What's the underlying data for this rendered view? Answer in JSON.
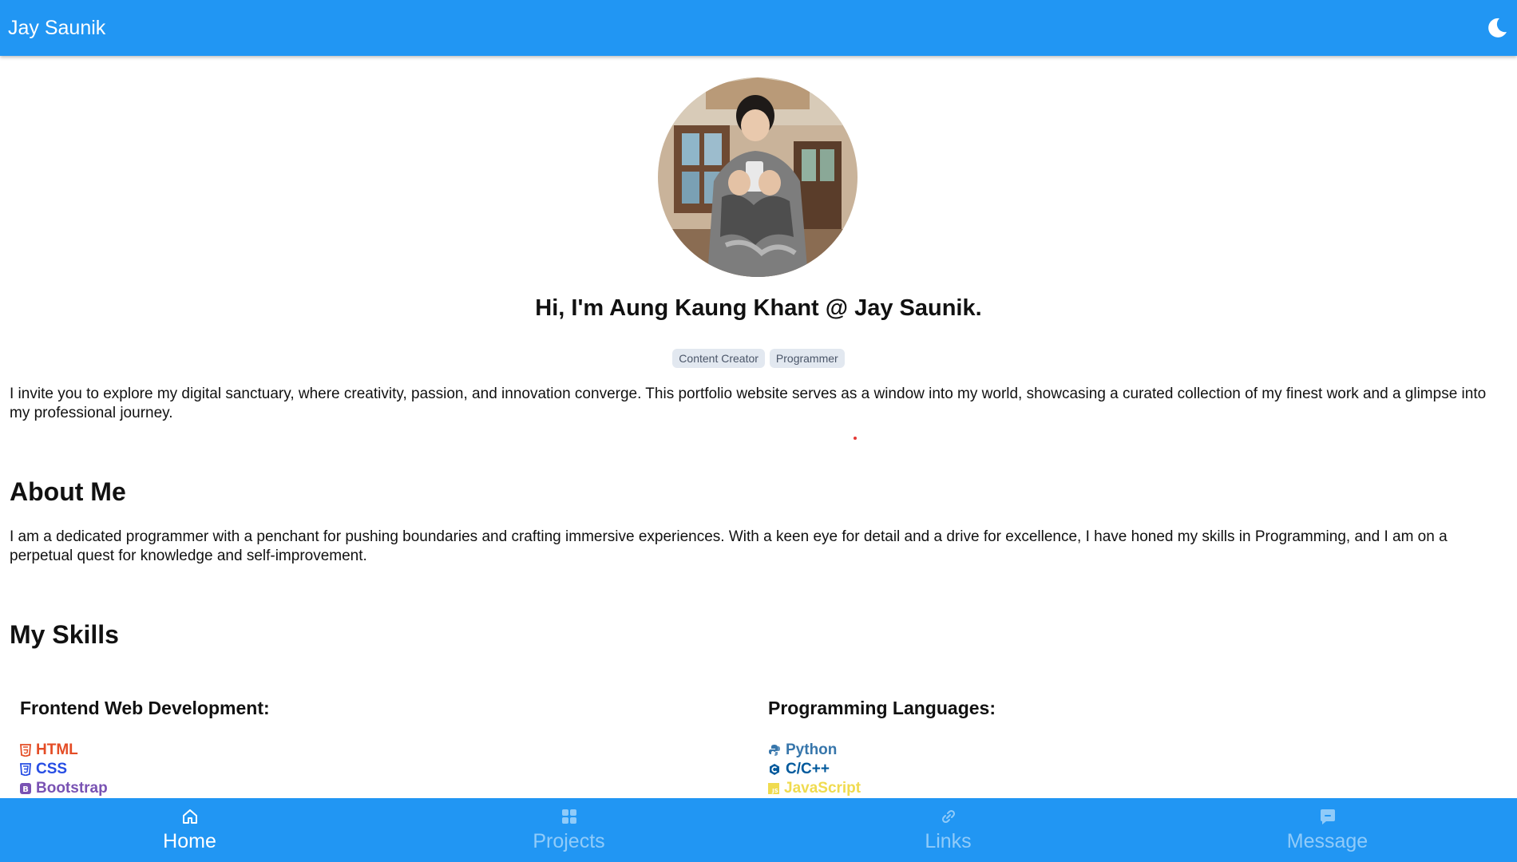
{
  "header": {
    "title": "Jay Saunik",
    "theme_icon": "moon-icon"
  },
  "profile": {
    "headline": "Hi, I'm Aung Kaung Khant @ Jay Saunik.",
    "badges": [
      "Content Creator",
      "Programmer"
    ],
    "intro": "I invite you to explore my digital sanctuary, where creativity, passion, and innovation converge. This portfolio website serves as a window into my world, showcasing a curated collection of my finest work and a glimpse into my professional journey."
  },
  "about": {
    "heading": "About Me",
    "text": "I am a dedicated programmer with a penchant for pushing boundaries and crafting immersive experiences. With a keen eye for detail and a drive for excellence, I have honed my skills in Programming, and I am on a perpetual quest for knowledge and self-improvement."
  },
  "skills": {
    "heading": "My Skills",
    "frontend": {
      "title": "Frontend Web Development:",
      "items": [
        {
          "label": "HTML",
          "icon": "html5-icon",
          "color": "#e44d26"
        },
        {
          "label": "CSS",
          "icon": "css3-icon",
          "color": "#264de4"
        },
        {
          "label": "Bootstrap",
          "icon": "bootstrap-icon",
          "color": "#7952b3"
        }
      ]
    },
    "languages": {
      "title": "Programming Languages:",
      "items": [
        {
          "label": "Python",
          "icon": "python-icon",
          "color": "#3776ab"
        },
        {
          "label": "C/C++",
          "icon": "c-icon",
          "color": "#00599c"
        },
        {
          "label": "JavaScript",
          "icon": "javascript-icon",
          "color": "#f0db4f"
        }
      ]
    }
  },
  "nav": {
    "items": [
      {
        "label": "Home",
        "icon": "home-icon",
        "active": true
      },
      {
        "label": "Projects",
        "icon": "grid-icon",
        "active": false
      },
      {
        "label": "Links",
        "icon": "link-icon",
        "active": false
      },
      {
        "label": "Message",
        "icon": "message-icon",
        "active": false
      }
    ]
  },
  "colors": {
    "primary": "#2196f3",
    "badge_bg": "#e2e8f0",
    "badge_text": "#4a5568"
  }
}
